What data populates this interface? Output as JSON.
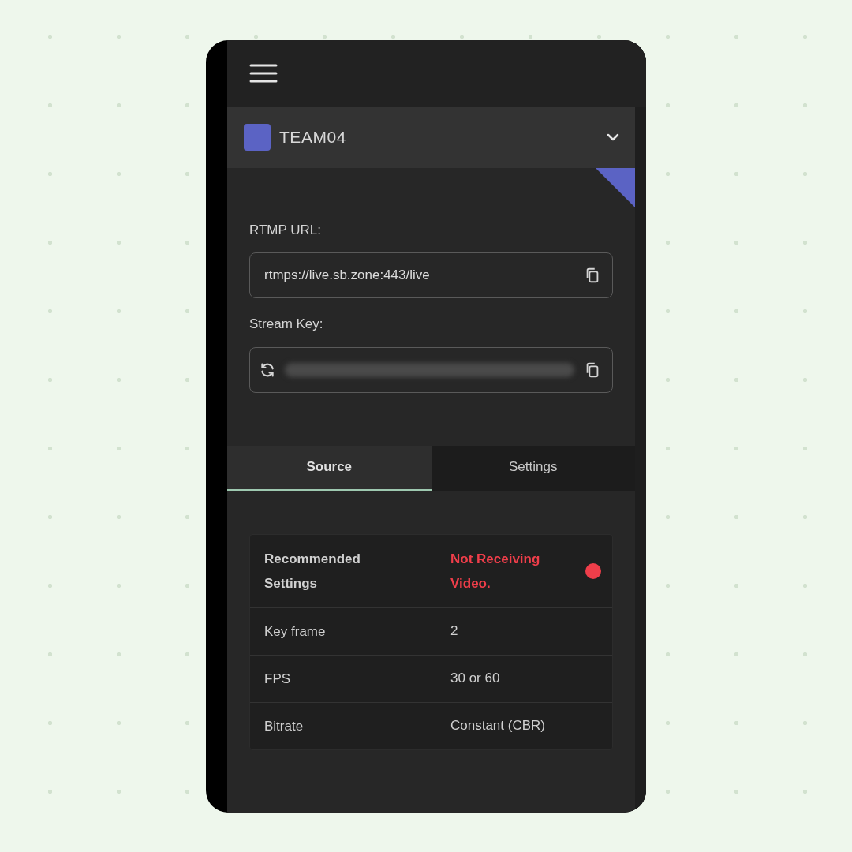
{
  "team": {
    "name": "TEAM04",
    "color": "#5b63c4"
  },
  "rtmp": {
    "label": "RTMP URL:",
    "value": "rtmps://live.sb.zone:443/live"
  },
  "stream_key": {
    "label": "Stream Key:"
  },
  "tabs": [
    {
      "label": "Source",
      "selected": true
    },
    {
      "label": "Settings",
      "selected": false
    }
  ],
  "table": {
    "rows": [
      {
        "kind": "status",
        "label": "Recommended Settings",
        "value": "Not Receiving Video.",
        "color": "#ef3e4a"
      },
      {
        "kind": "plain",
        "label": "Key frame",
        "value": "2"
      },
      {
        "kind": "plain",
        "label": "FPS",
        "value": "30 or 60"
      },
      {
        "kind": "plain",
        "label": "Bitrate",
        "value": "Constant (CBR)"
      }
    ]
  }
}
